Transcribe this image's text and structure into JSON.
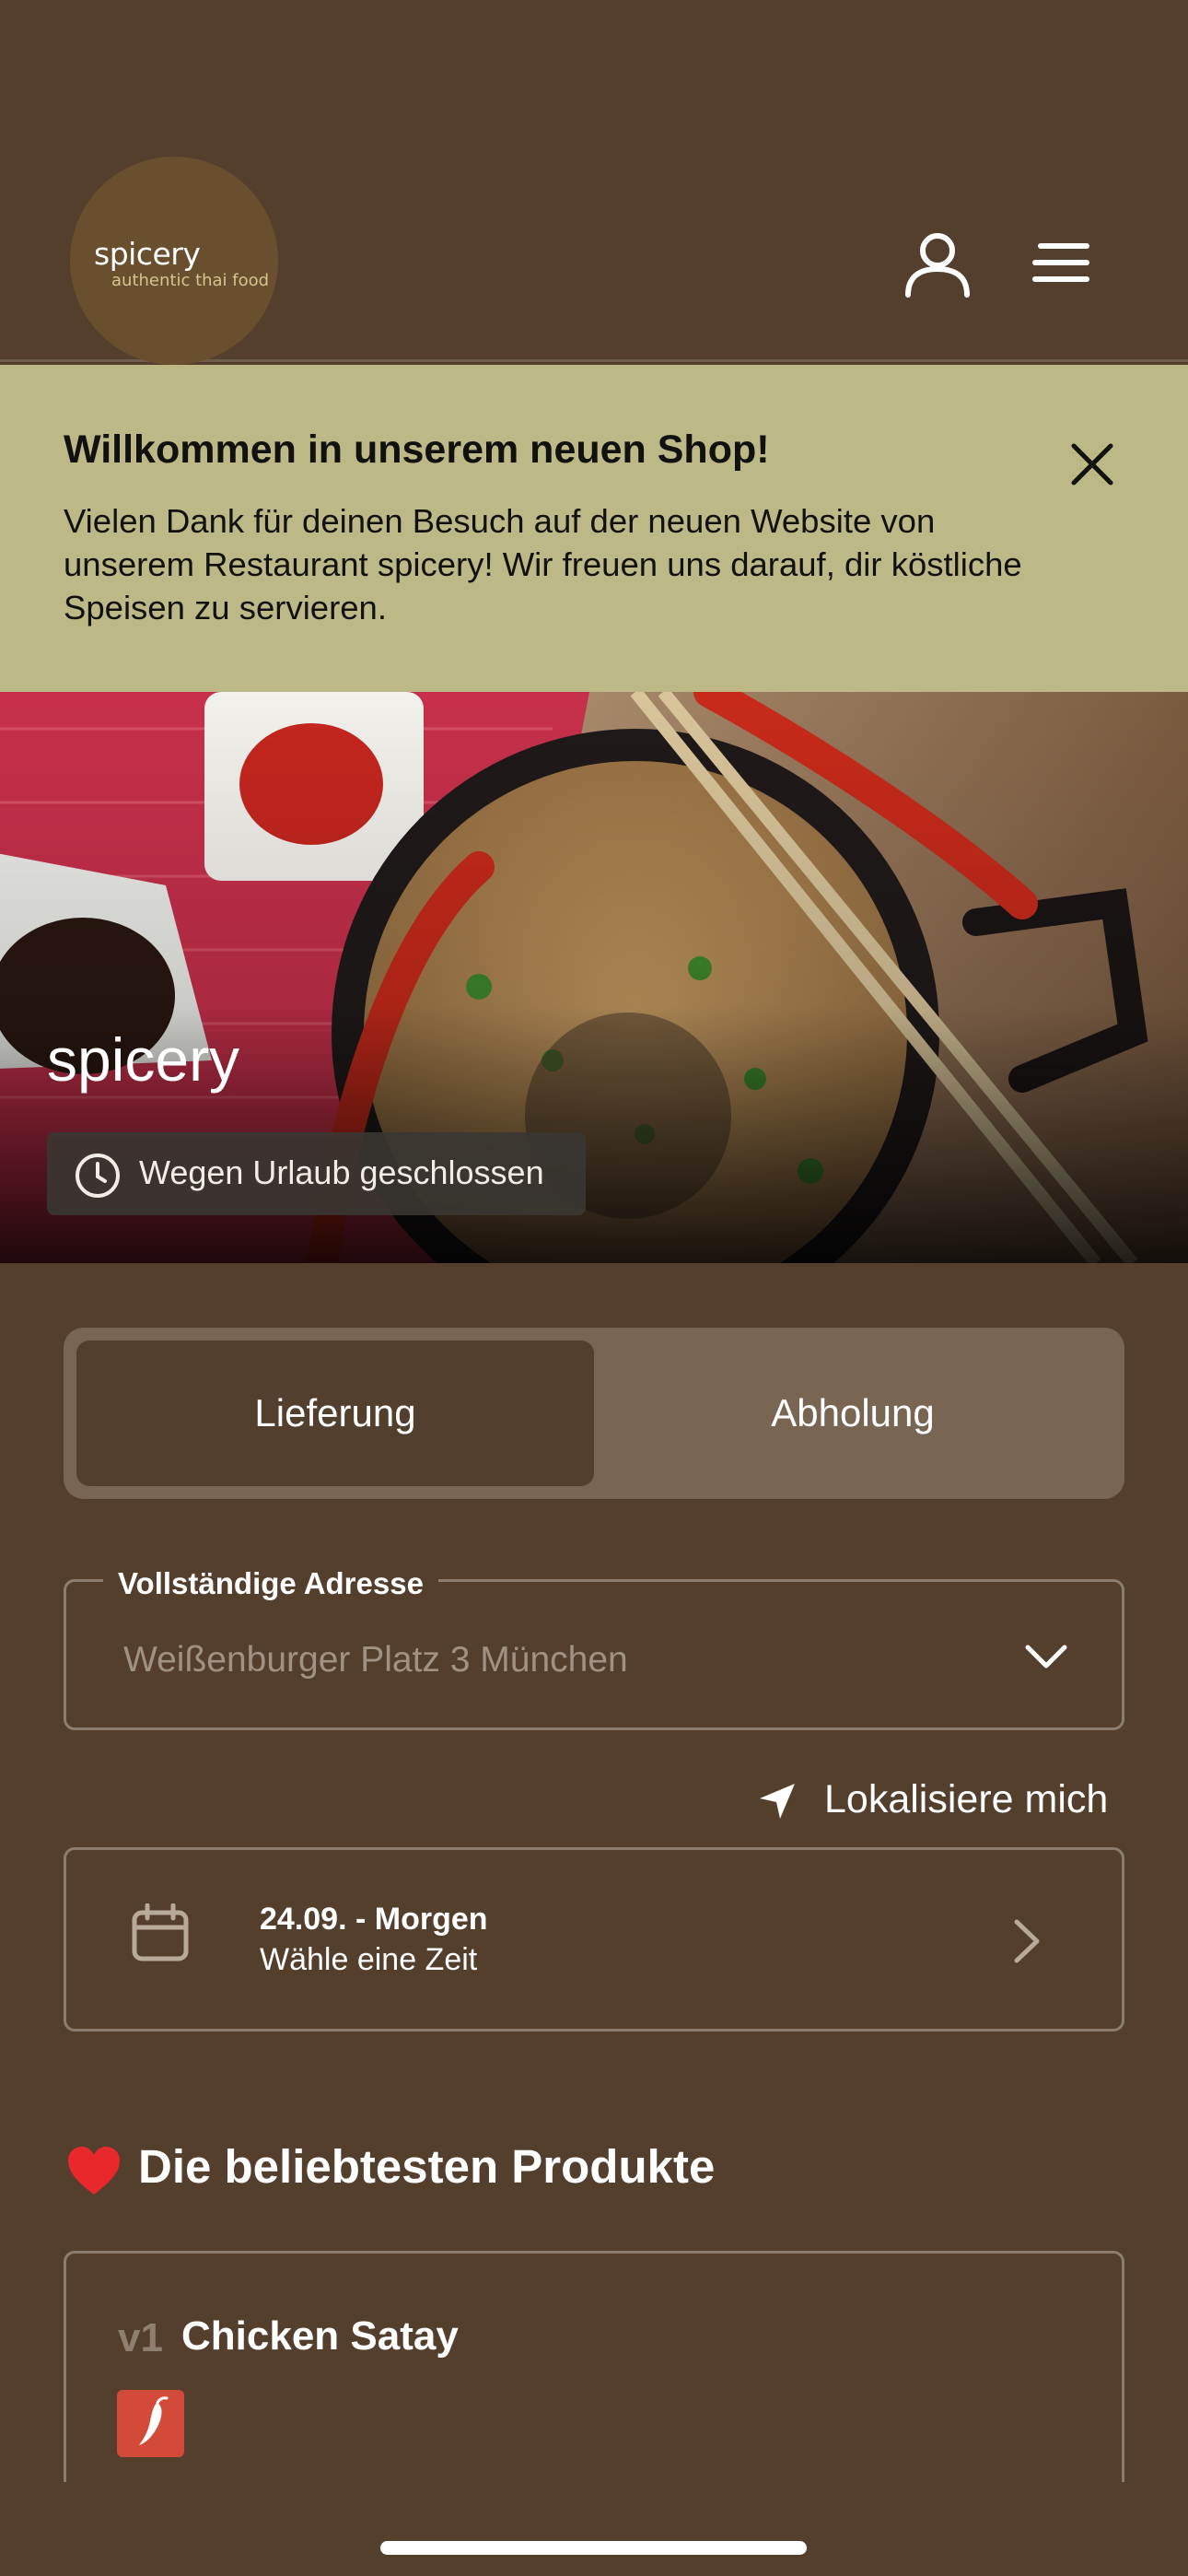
{
  "header": {
    "logo_name": "spicery",
    "logo_tagline": "authentic thai food",
    "user_icon": "user-icon",
    "menu_icon": "menu-icon"
  },
  "banner": {
    "title": "Willkommen in unserem neuen Shop!",
    "text": "Vielen Dank für deinen Besuch auf der neuen Website von unserem Restaurant spicery! Wir freuen uns darauf, dir köstliche Speisen zu servieren.",
    "close_icon": "close-icon",
    "background": "#bdb987"
  },
  "hero": {
    "title": "spicery",
    "status": "Wegen Urlaub geschlossen",
    "status_icon": "clock-icon",
    "watermark_name": "spicery",
    "watermark_tagline": "authentic thai food"
  },
  "order_mode": {
    "options": [
      "Lieferung",
      "Abholung"
    ],
    "selected": "Lieferung"
  },
  "address": {
    "label": "Vollständige Adresse",
    "placeholder": "Weißenburger Platz 3 München"
  },
  "locate": {
    "label": "Lokalisiere mich",
    "icon": "location-arrow-icon"
  },
  "time": {
    "date": "24.09. - Morgen",
    "hint": "Wähle eine Zeit",
    "icon": "calendar-icon"
  },
  "popular": {
    "heading": "Die beliebtesten Produkte",
    "icon": "heart-icon",
    "products": [
      {
        "number": "v1",
        "name": "Chicken Satay",
        "badge_icon": "chili-icon"
      }
    ]
  },
  "colors": {
    "background": "#543f2d",
    "banner": "#bdb987",
    "toggle_track": "#786552",
    "chili_badge": "#d44a38"
  }
}
